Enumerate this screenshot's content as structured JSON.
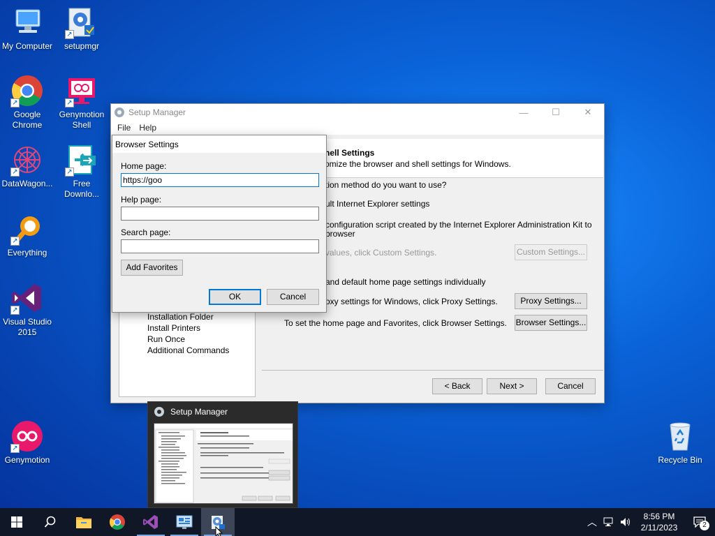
{
  "desktop": {
    "icons": [
      {
        "label": "My Computer"
      },
      {
        "label": "setupmgr"
      },
      {
        "label": "Google Chrome"
      },
      {
        "label": "Genymotion Shell"
      },
      {
        "label": "DataWagon..."
      },
      {
        "label": "Free Downlo..."
      },
      {
        "label": "Everything"
      },
      {
        "label": "Visual Studio 2015"
      },
      {
        "label": "Genymotion"
      },
      {
        "label": "Recycle Bin"
      }
    ]
  },
  "window": {
    "title": "Setup Manager",
    "menu": [
      "File",
      "Help"
    ],
    "tree_items": [
      "Installation Folder",
      "Install Printers",
      "Run Once",
      "Additional Commands"
    ],
    "header_title": "hell Settings",
    "header_subtitle": "omize the browser and shell settings for Windows.",
    "question": "tion method do you want to use?",
    "option1": "ult Internet Explorer settings",
    "option2_line1": "configuration script created by the Internet Explorer Administration Kit to",
    "option2_line2": "browser",
    "custom_text": "values, click Custom Settings.",
    "custom_button": "Custom Settings...",
    "option3": "and default home page settings individually",
    "proxy_text": "oxy settings for Windows, click Proxy Settings.",
    "proxy_button": "Proxy Settings...",
    "browser_text": "To set the home page and Favorites, click Browser Settings.",
    "browser_button": "Browser Settings...",
    "back_button": "< Back",
    "next_button": "Next >",
    "cancel_button": "Cancel"
  },
  "dialog": {
    "title": "Browser Settings",
    "home_label": "Home page:",
    "home_value": "https://goo",
    "help_label": "Help page:",
    "help_value": "",
    "search_label": "Search page:",
    "search_value": "",
    "add_favorites": "Add Favorites",
    "ok": "OK",
    "cancel": "Cancel"
  },
  "preview": {
    "title": "Setup Manager"
  },
  "taskbar": {
    "time": "8:56 PM",
    "date": "2/11/2023",
    "notification_count": "2"
  }
}
